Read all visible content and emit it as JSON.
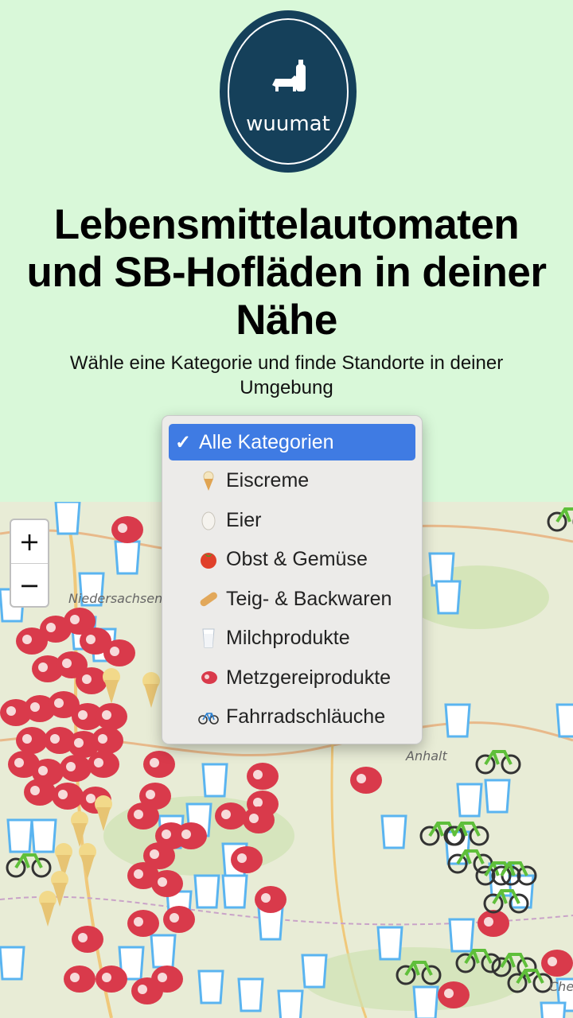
{
  "logo": {
    "text": "wuumat"
  },
  "header": {
    "title": "Lebensmittelautomaten und SB-Hofläden in deiner Nähe",
    "subtitle": "Wähle eine Kategorie und finde Standorte in deiner Umgebung"
  },
  "map": {
    "zoom_in": "+",
    "zoom_out": "−",
    "labels": [
      "Niedersachsen",
      "Anhalt",
      "Che"
    ]
  },
  "categories": {
    "check": "✓",
    "selected": "Alle Kategorien",
    "items": [
      {
        "label": "Alle Kategorien",
        "icon": "checkmark"
      },
      {
        "label": "Eiscreme",
        "icon": "ice-cream-icon"
      },
      {
        "label": "Eier",
        "icon": "egg-icon"
      },
      {
        "label": "Obst & Gemüse",
        "icon": "tomato-icon"
      },
      {
        "label": "Teig- & Backwaren",
        "icon": "bread-icon"
      },
      {
        "label": "Milchprodukte",
        "icon": "milk-glass-icon"
      },
      {
        "label": "Metzgereiprodukte",
        "icon": "meat-icon"
      },
      {
        "label": "Fahrradschläuche",
        "icon": "bicycle-icon"
      }
    ]
  },
  "colors": {
    "background": "#d9f8d9",
    "logo": "#15405a",
    "selection": "#3f7be3",
    "meat": "#d93a4b",
    "milk": "#5ab4f0",
    "bike": "#5fbf3a",
    "icecream": "#f2d98a"
  }
}
